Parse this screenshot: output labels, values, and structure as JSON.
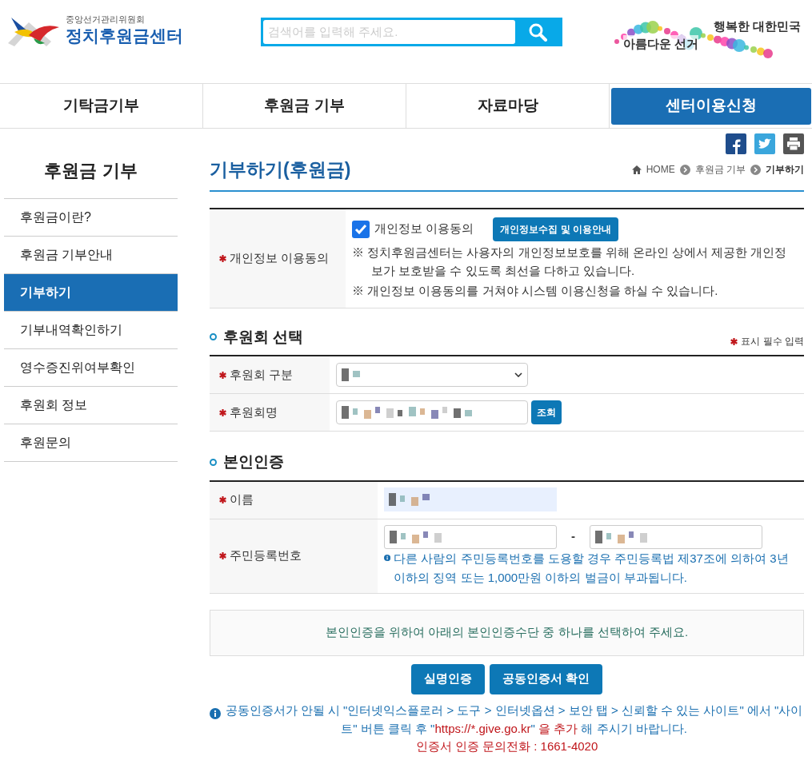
{
  "header": {
    "org": "중앙선거관리위원회",
    "site": "정치후원금센터",
    "search": {
      "placeholder": "검색어를 입력해 주세요."
    },
    "slogan": {
      "top": "행복한 대한민국",
      "bottom": "아름다운 선거"
    }
  },
  "nav": [
    {
      "label": "기탁금기부",
      "selected": false
    },
    {
      "label": "후원금 기부",
      "selected": false
    },
    {
      "label": "자료마당",
      "selected": false
    },
    {
      "label": "센터이용신청",
      "selected": true
    }
  ],
  "sidebar": {
    "title": "후원금 기부",
    "items": [
      {
        "label": "후원금이란?",
        "selected": false
      },
      {
        "label": "후원금 기부안내",
        "selected": false
      },
      {
        "label": "기부하기",
        "selected": true
      },
      {
        "label": "기부내역확인하기",
        "selected": false
      },
      {
        "label": "영수증진위여부확인",
        "selected": false
      },
      {
        "label": "후원회 정보",
        "selected": false
      },
      {
        "label": "후원문의",
        "selected": false
      }
    ]
  },
  "page_title": "기부하기(후원금)",
  "breadcrumb": [
    "HOME",
    "후원금 기부",
    "기부하기"
  ],
  "consent": {
    "label": "개인정보 이용동의",
    "checkbox": {
      "label": "개인정보 이용동의",
      "checked": true
    },
    "guide_button": "개인정보수집 및 이용안내",
    "notes": [
      "※ 정치후원금센터는 사용자의 개인정보보호를 위해 온라인 상에서 제공한 개인정보가 보호받을 수 있도록 최선을 다하고 있습니다.",
      "※ 개인정보 이용동의를 거쳐야 시스템 이용신청을 하실 수 있습니다."
    ]
  },
  "support_section": {
    "title": "후원회 선택",
    "required_note": "표시 필수 입력",
    "rows": [
      {
        "label": "후원회 구분",
        "kind": "select"
      },
      {
        "label": "후원회명",
        "kind": "search",
        "button": "조회"
      }
    ]
  },
  "identity_section": {
    "title": "본인인증",
    "rows": [
      {
        "label": "이름",
        "kind": "name"
      },
      {
        "label": "주민등록번호",
        "kind": "rrn",
        "separator": "-",
        "notice": "다른 사람의 주민등록번호를 도용할 경우 주민등록법 제37조에 의하여 3년 이하의 징역 또는 1,000만원 이하의 벌금이 부과됩니다."
      }
    ]
  },
  "auth_prompt": "본인인증을 위하여 아래의 본인인증수단 중 하나를 선택하여 주세요.",
  "auth_buttons": [
    "실명인증",
    "공동인증서 확인"
  ],
  "help": {
    "segments": [
      {
        "text": "공동인증서가 안될 시 \"인터넷익스플로러 > 도구 > 인터넷옵션 > 보안 탭 > 신뢰할 수 있는 사이트\" 에서 \"사이트\" 버튼 클릭 후 \"",
        "kind": "plain"
      },
      {
        "text": "https://*.give.go.kr",
        "kind": "url"
      },
      {
        "text": "\" ",
        "kind": "plain"
      },
      {
        "text": "을 추가",
        "kind": "alert"
      },
      {
        "text": " 해 주시기 바랍니다.",
        "kind": "plain"
      }
    ],
    "phone": "인증서 인증 문의전화 : 1661-4020"
  }
}
